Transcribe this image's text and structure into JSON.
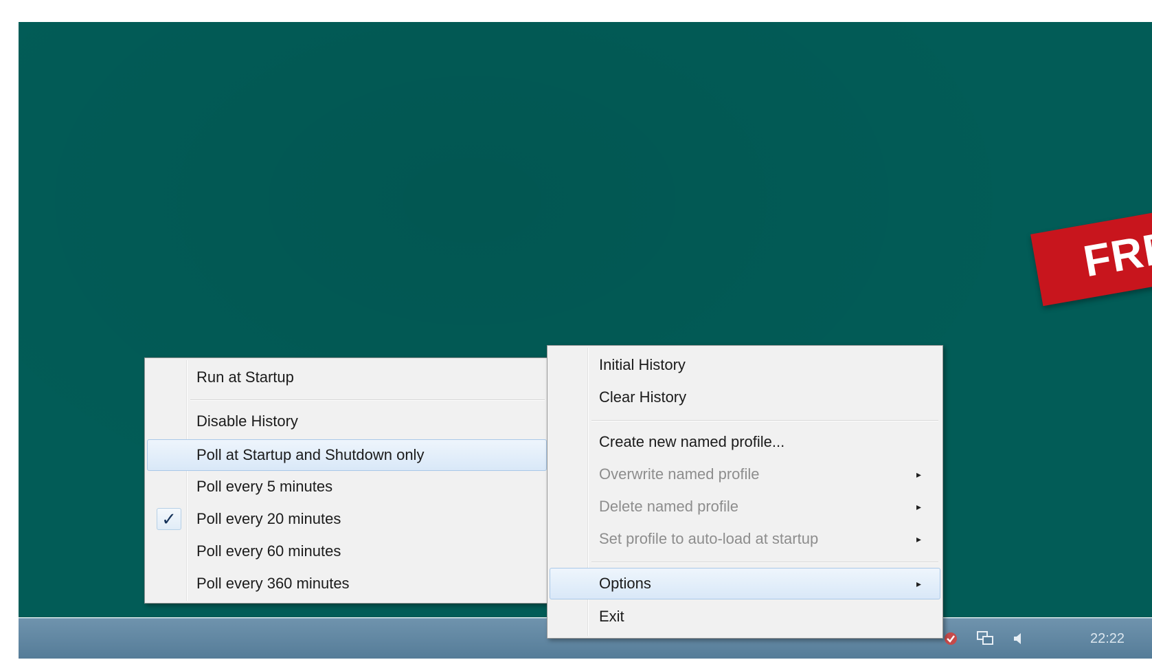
{
  "banner": {
    "text": "FREE"
  },
  "options_submenu": {
    "items": [
      {
        "label": "Run at Startup",
        "state": "normal"
      },
      {
        "label": "Disable History",
        "state": "normal"
      },
      {
        "label": "Poll at Startup and Shutdown only",
        "state": "hover"
      },
      {
        "label": "Poll every 5 minutes",
        "state": "normal"
      },
      {
        "label": "Poll every 20 minutes",
        "state": "checked",
        "check_glyph": "✓"
      },
      {
        "label": "Poll every 60 minutes",
        "state": "normal"
      },
      {
        "label": "Poll every 360 minutes",
        "state": "normal"
      }
    ]
  },
  "main_menu": {
    "items": [
      {
        "label": "Initial History",
        "state": "normal"
      },
      {
        "label": "Clear History",
        "state": "normal"
      },
      {
        "label": "Create new named profile...",
        "state": "normal"
      },
      {
        "label": "Overwrite named profile",
        "state": "disabled",
        "submenu_arrow": "▸"
      },
      {
        "label": "Delete named profile",
        "state": "disabled",
        "submenu_arrow": "▸"
      },
      {
        "label": "Set profile to auto-load at startup",
        "state": "disabled",
        "submenu_arrow": "▸"
      },
      {
        "label": "Options",
        "state": "hover",
        "submenu_arrow": "▸"
      },
      {
        "label": "Exit",
        "state": "normal"
      }
    ]
  },
  "taskbar": {
    "clock": "22:22",
    "tray_icons": [
      "app-icon",
      "network-icon",
      "volume-icon"
    ]
  },
  "colors": {
    "desktop": "#025c57",
    "banner": "#c8151d",
    "menu_background": "#f1f1f1",
    "highlight": "#d9e8f8"
  }
}
